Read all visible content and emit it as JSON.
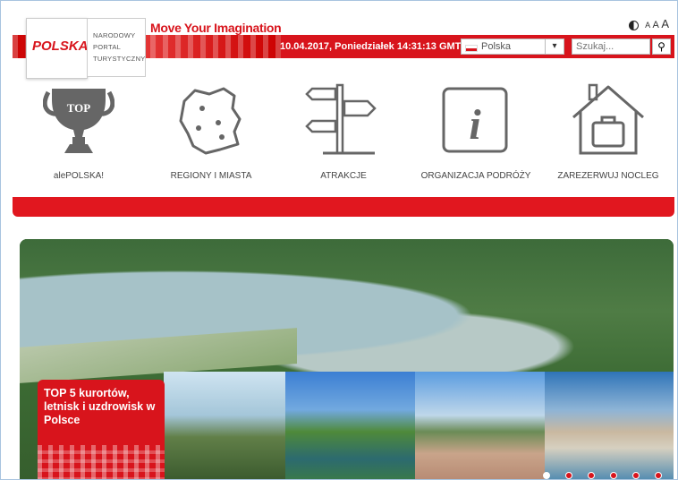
{
  "header": {
    "tagline": "Move Your Imagination",
    "logo_text": "POLSKA",
    "portal_lines": [
      "NARODOWY",
      "PORTAL",
      "TURYSTYCZNY"
    ],
    "datetime": "10.04.2017, Poniedziałek 14:31:13 GMT+1",
    "country_select": {
      "value": "Polska"
    },
    "search": {
      "placeholder": "Szukaj..."
    },
    "font_sizes": [
      "A",
      "A",
      "A"
    ]
  },
  "nav": {
    "items": [
      {
        "label": "alePOLSKA!",
        "icon": "trophy-icon",
        "icon_text": "TOP"
      },
      {
        "label": "REGIONY I MIASTA",
        "icon": "map-poland-icon"
      },
      {
        "label": "ATRAKCJE",
        "icon": "signpost-icon"
      },
      {
        "label": "ORGANIZACJA PODRÓŻY",
        "icon": "info-icon",
        "icon_text": "i"
      },
      {
        "label": "ZAREZERWUJ NOCLEG",
        "icon": "house-suitcase-icon"
      }
    ]
  },
  "hero": {
    "promo": {
      "title": "TOP 5 kurortów, letnisk i uzdrowisk w Polsce"
    },
    "slides_count": 6,
    "active_slide": 1
  },
  "colors": {
    "brand_red": "#d8141c",
    "icon_gray": "#666666"
  }
}
